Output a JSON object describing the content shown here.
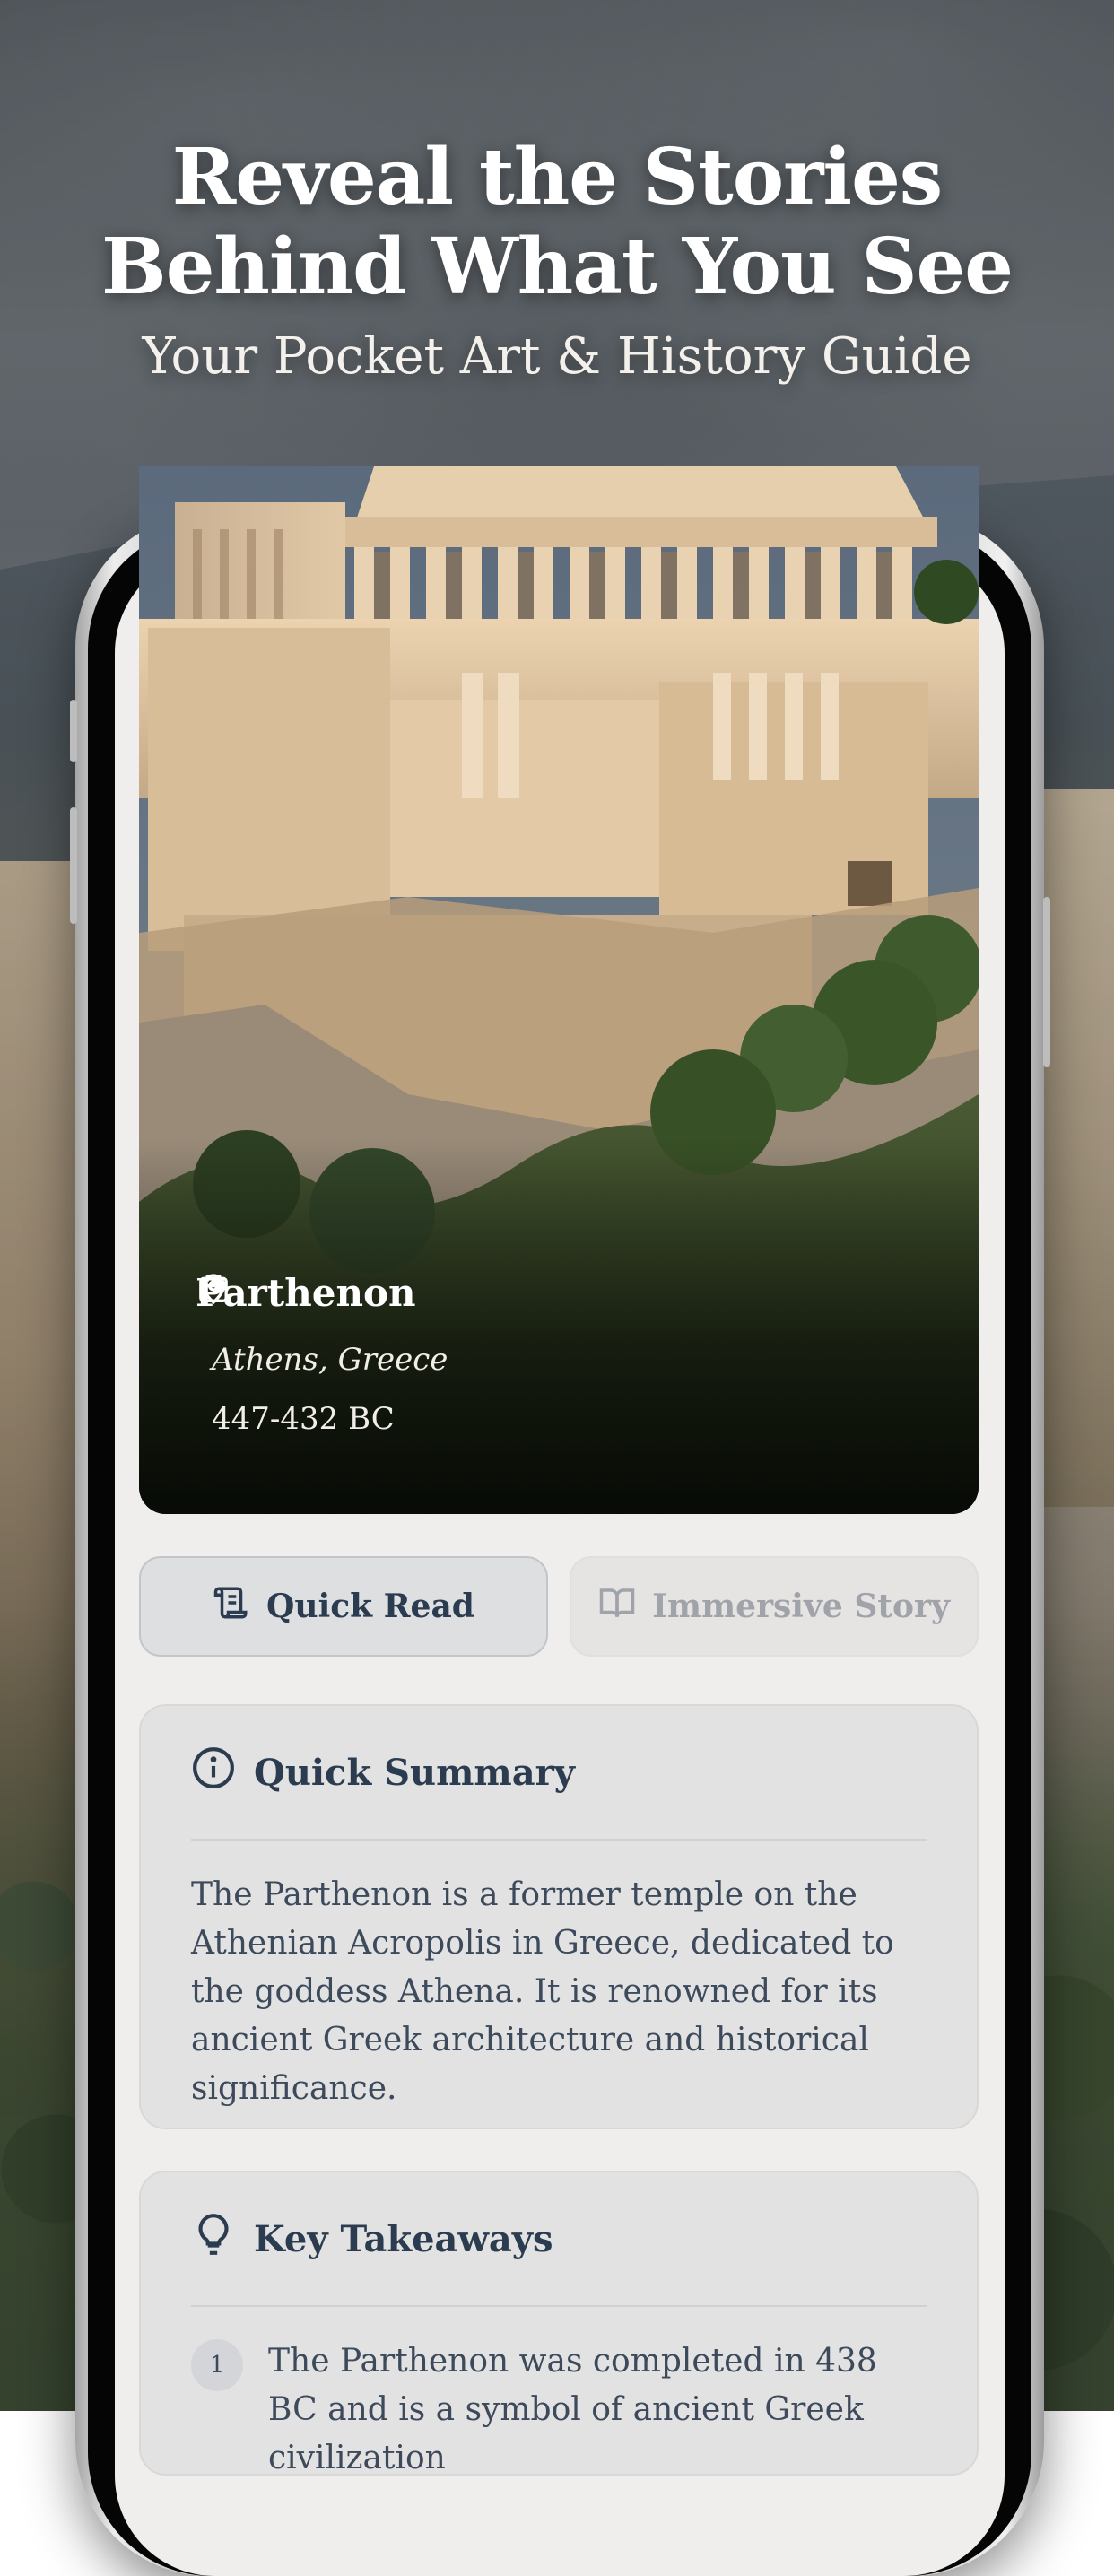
{
  "hero": {
    "title_line1": "Reveal the Stories",
    "title_line2": "Behind What You See",
    "subtitle": "Your Pocket Art & History Guide"
  },
  "place": {
    "name": "Parthenon",
    "location": "Athens, Greece",
    "date": "447-432 BC",
    "location_icon": "map-pin-icon",
    "date_icon": "calendar-icon"
  },
  "tabs": [
    {
      "label": "Quick Read",
      "icon": "scroll-icon",
      "active": true
    },
    {
      "label": "Immersive Story",
      "icon": "open-book-icon",
      "active": false
    }
  ],
  "summary": {
    "title": "Quick Summary",
    "icon": "info-icon",
    "text": "The Parthenon is a former temple on the Athenian Acropolis in Greece, dedicated to the goddess Athena. It is renowned for its ancient Greek architecture and historical significance."
  },
  "takeaways": {
    "title": "Key Takeaways",
    "icon": "lightbulb-icon",
    "items": [
      {
        "number": "1",
        "text": "The Parthenon was completed in 438 BC and is a symbol of ancient Greek civilization"
      }
    ]
  },
  "colors": {
    "heading_navy": "#2b3c50",
    "body_text": "#3c4a5c",
    "screen_bg": "#f0eeec",
    "card_bg": "#e3e2e2"
  }
}
